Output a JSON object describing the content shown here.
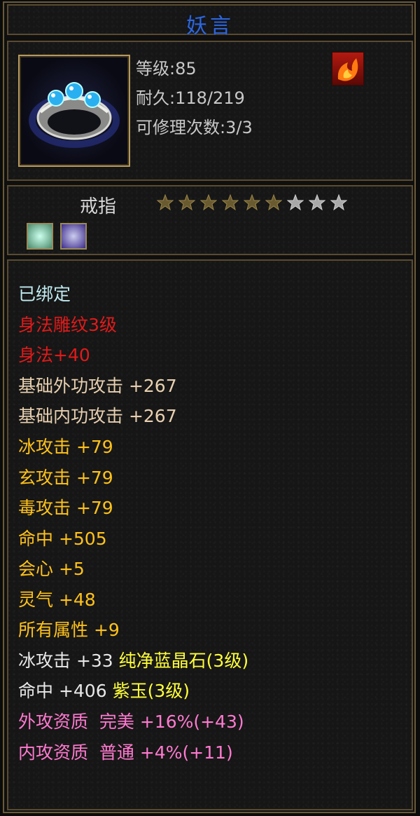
{
  "item": {
    "name": "妖言",
    "level": "等级:85",
    "durability": "耐久:118/219",
    "repairs": "可修理次数:3/3",
    "type": "戒指",
    "stars_filled": 6,
    "stars_total": 9
  },
  "icons": {
    "item": "silver-ring-blue-gems-icon",
    "element": "fire-element-icon",
    "gem1": "jade-gem-icon",
    "gem2": "purple-gem-icon"
  },
  "colors": {
    "title": "#2f66d8",
    "bound": "#bfe9ef",
    "engraving": "#e01a1a",
    "base": "#e8d0b0",
    "attr": "#ffc21a",
    "gem": "#ffff3a",
    "aptitude": "#ff7ad0"
  },
  "stats": {
    "bound": "已绑定",
    "engraving": "身法雕纹3级",
    "agility": "身法+40",
    "ext_attack": "基础外功攻击 +267",
    "int_attack": "基础内功攻击 +267",
    "ice_attack": "冰攻击 +79",
    "mystic_attack": "玄攻击 +79",
    "poison_attack": "毒攻击 +79",
    "hit": "命中 +505",
    "crit": "会心 +5",
    "spirit": "灵气 +48",
    "all_attr": "所有属性 +9",
    "gem1_stat": "冰攻击 +33 ",
    "gem1_name": "纯净蓝晶石(3级)",
    "gem2_stat": "命中 +406 ",
    "gem2_name": "紫玉(3级)",
    "ext_aptitude": "外攻资质  完美 +16%(+43)",
    "int_aptitude": "内攻资质  普通 +4%(+11)"
  }
}
